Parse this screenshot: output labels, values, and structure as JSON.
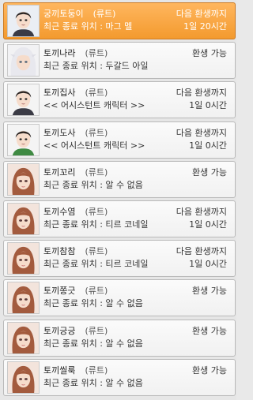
{
  "characters": [
    {
      "name": "궁끼토둥이",
      "tag": "(류트)",
      "status": "다음 환생까지",
      "location": "최근 종료 위치 : 마그 멜",
      "time": "1일 20시간",
      "avatar": "character-male-a",
      "selected": true
    },
    {
      "name": "토끼나라",
      "tag": "(류트)",
      "status": "환생 가능",
      "location": "최근 종료 위치 : 두갈드 아일",
      "time": "",
      "avatar": "character-giant",
      "selected": false
    },
    {
      "name": "토끼집사",
      "tag": "(류트)",
      "status": "다음 환생까지",
      "location": "<< 어시스턴트 캐릭터 >>",
      "time": "1일 0시간",
      "avatar": "character-male-b",
      "selected": false
    },
    {
      "name": "토끼도사",
      "tag": "(류트)",
      "status": "다음 환생까지",
      "location": "<< 어시스턴트 캐릭터 >>",
      "time": "1일 0시간",
      "avatar": "character-male-c",
      "selected": false
    },
    {
      "name": "토끼꼬리",
      "tag": "(류트)",
      "status": "환생 가능",
      "location": "최근 종료 위치 : 알 수 없음",
      "time": "",
      "avatar": "character-female",
      "selected": false
    },
    {
      "name": "토끼수염",
      "tag": "(류트)",
      "status": "다음 환생까지",
      "location": "최근 종료 위치 : 티르 코네일",
      "time": "1일 0시간",
      "avatar": "character-female",
      "selected": false
    },
    {
      "name": "토끼참참",
      "tag": "(류트)",
      "status": "다음 환생까지",
      "location": "최근 종료 위치 : 티르 코네일",
      "time": "1일 0시간",
      "avatar": "character-female",
      "selected": false
    },
    {
      "name": "토끼쫑긋",
      "tag": "(류트)",
      "status": "환생 가능",
      "location": "최근 종료 위치 : 알 수 없음",
      "time": "",
      "avatar": "character-female",
      "selected": false
    },
    {
      "name": "토끼긍긍",
      "tag": "(류트)",
      "status": "환생 가능",
      "location": "최근 종료 위치 : 알 수 없음",
      "time": "",
      "avatar": "character-female",
      "selected": false
    },
    {
      "name": "토끼씰룩",
      "tag": "(류트)",
      "status": "환생 가능",
      "location": "최근 종료 위치 : 알 수 없음",
      "time": "",
      "avatar": "character-female",
      "selected": false
    }
  ],
  "colors": {
    "selected": "#f5a040",
    "row": "#f6f6f6",
    "border": "#b9b9b9",
    "hair_female": "#a35b3e",
    "hair_male": "#2a2422",
    "skin": "#f6dccb"
  }
}
